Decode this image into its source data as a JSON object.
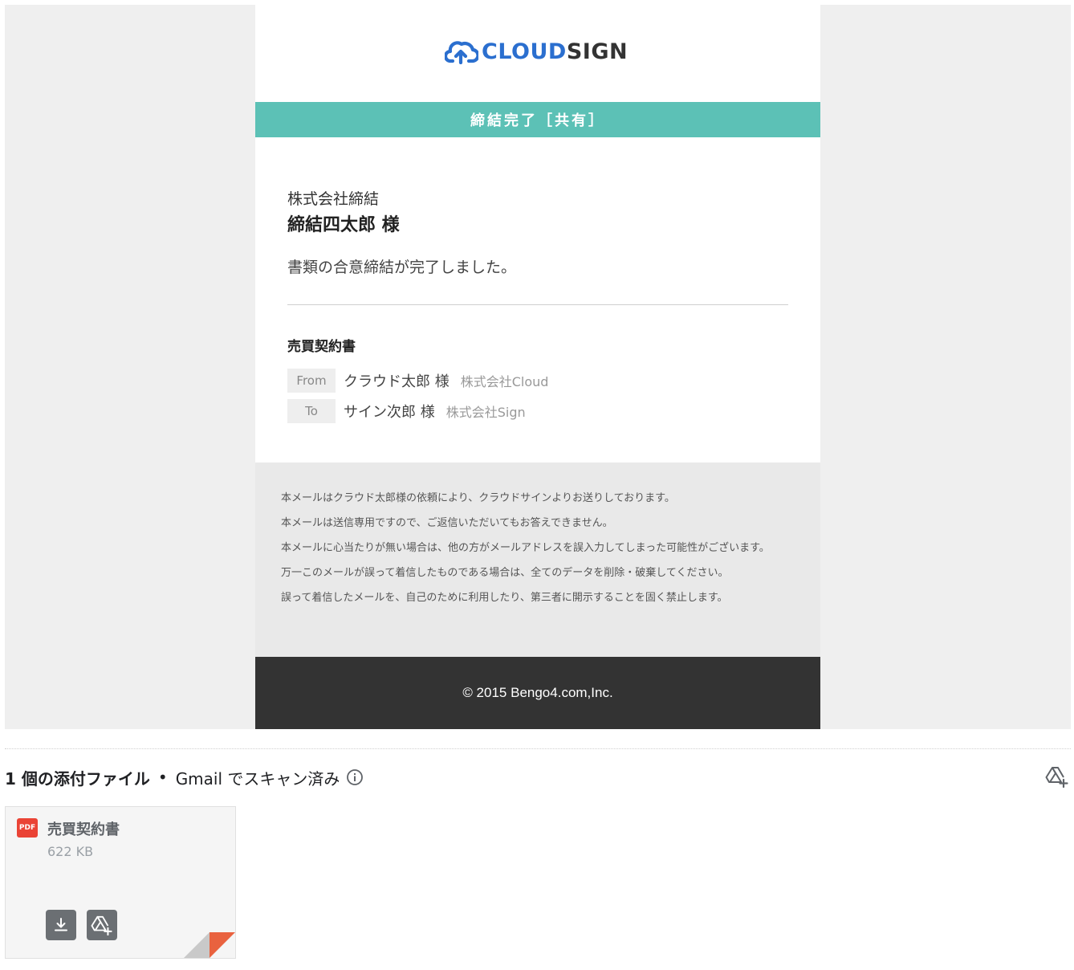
{
  "email": {
    "logo": {
      "part1": "CLOUD",
      "part2": "SIGN",
      "icon": "cloud-upload-icon",
      "colors": {
        "cloud": "#2b6fcf",
        "sign": "#333333"
      }
    },
    "banner": {
      "text": "締結完了［共有］",
      "color": "#5cc1b6"
    },
    "recipient": {
      "company": "株式会社締結",
      "name": "締結四太郎 様"
    },
    "message": "書類の合意締結が完了しました。",
    "document": {
      "title": "売買契約書",
      "from": {
        "label": "From",
        "name": "クラウド太郎 様",
        "company": "株式会社Cloud"
      },
      "to": {
        "label": "To",
        "name": "サイン次郎 様",
        "company": "株式会社Sign"
      }
    },
    "notices": [
      "本メールはクラウド太郎様の依頼により、クラウドサインよりお送りしております。",
      "本メールは送信専用ですので、ご返信いただいてもお答えできません。",
      "本メールに心当たりが無い場合は、他の方がメールアドレスを誤入力してしまった可能性がございます。",
      "万一このメールが誤って着信したものである場合は、全てのデータを削除・破棄してください。",
      "誤って着信したメールを、自己のために利用したり、第三者に開示することを固く禁止します。"
    ],
    "footer": "© 2015 Bengo4.com,Inc."
  },
  "attachments": {
    "count_label": "1 個の添付ファイル",
    "separator": "•",
    "scan_label": "Gmail でスキャン済み",
    "items": [
      {
        "type_badge": "PDF",
        "name": "売買契約書",
        "size": "622 KB",
        "badge_color": "#ea4335"
      }
    ]
  }
}
